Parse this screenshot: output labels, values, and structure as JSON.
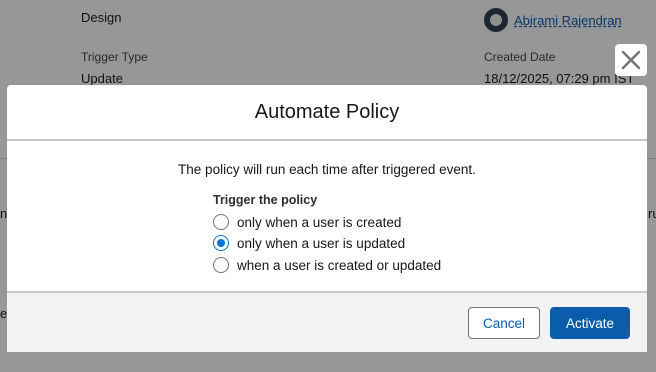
{
  "background": {
    "status_value": "Design",
    "trigger_type_label": "Trigger Type",
    "trigger_type_value": "Update",
    "created_by_user": "Abirami Rajendran",
    "created_date_label": "Created Date",
    "created_date_value": "18/12/2025, 07:29 pm IST",
    "left_fragment_1": "n",
    "left_fragment_2": "es",
    "right_fragment": "ru"
  },
  "modal": {
    "title": "Automate Policy",
    "description": "The policy will run each time after triggered event.",
    "group_label": "Trigger the policy",
    "options": [
      {
        "label": "only when a user is created",
        "checked": false
      },
      {
        "label": "only when a user is updated",
        "checked": true
      },
      {
        "label": "when a user is created or updated",
        "checked": false
      }
    ],
    "cancel_label": "Cancel",
    "activate_label": "Activate"
  },
  "colors": {
    "accent": "#0176d3",
    "brand_button": "#0b5cab",
    "backdrop": "#080707"
  },
  "icons": {
    "close": "close-icon",
    "avatar": "user-avatar-icon"
  }
}
